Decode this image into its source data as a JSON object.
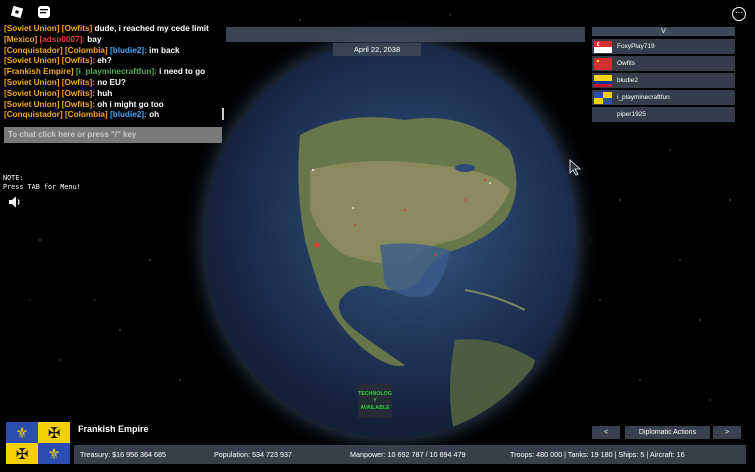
{
  "chat": {
    "messages": [
      {
        "tag": "[Soviet Union]",
        "tag_color": "#f5a623",
        "team": "[Owfits]",
        "team_color": "#f5a623",
        "text": "dude, i reached my cede limit"
      },
      {
        "tag": "[Mexico]",
        "tag_color": "#f5a623",
        "team": "[adso0007]:",
        "team_color": "#e53935",
        "text": "bay"
      },
      {
        "tag": "[Conquistador]",
        "tag_color": "#f5a623",
        "team": "[Colombia]",
        "team_color": "#f5a623",
        "name": "[bludie2]:",
        "name_color": "#42a5f5",
        "text": "im back"
      },
      {
        "tag": "[Soviet Union]",
        "tag_color": "#f5a623",
        "team": "[Owfits]:",
        "team_color": "#f5a623",
        "text": "eh?"
      },
      {
        "tag": "[Frankish Empire]",
        "tag_color": "#f5a623",
        "team": "[i_playminecraftfun]:",
        "team_color": "#4caf50",
        "text": "i need to go"
      },
      {
        "tag": "[Soviet Union]",
        "tag_color": "#f5a623",
        "team": "[Owfits]:",
        "team_color": "#f5a623",
        "text": "no EU?"
      },
      {
        "tag": "[Soviet Union]",
        "tag_color": "#f5a623",
        "team": "[Owfits]:",
        "team_color": "#f5a623",
        "text": "huh"
      },
      {
        "tag": "[Soviet Union]",
        "tag_color": "#f5a623",
        "team": "[Owfits]:",
        "team_color": "#f5a623",
        "text": "oh i might go too"
      },
      {
        "tag": "[Conquistador]",
        "tag_color": "#f5a623",
        "team": "[Colombia]",
        "team_color": "#f5a623",
        "name": "[bludie2]:",
        "name_color": "#42a5f5",
        "text": "oh"
      }
    ],
    "input_placeholder": "To chat click here or press \"/\" key"
  },
  "date": "April 22, 2038",
  "note": {
    "line1": "NOTE:",
    "line2": "Press TAB for Menu!"
  },
  "players": {
    "header": "V",
    "list": [
      {
        "name": "FoxyPlay719",
        "flag": "flag-red-white-crescent"
      },
      {
        "name": "Owfits",
        "flag": "flag-red-star"
      },
      {
        "name": "bludie2",
        "flag": "flag-colombia"
      },
      {
        "name": "i_playminecraftfun",
        "flag": "flag-frankish"
      },
      {
        "name": "piper1925",
        "flag": ""
      }
    ]
  },
  "tech_notice": "TECHNOLOG Y AVAILABLE",
  "country": {
    "name": "Frankish Empire"
  },
  "stats": {
    "treasury": "Treasury:  $16 956 364 685",
    "population": "Population: 534 723 937",
    "manpower": "Manpower:  10 692 787  /  10 694 479",
    "military": "Troops: 480 000  |  Tanks: 19 180  |  Ships: 5  |  Aircraft: 16"
  },
  "diplomacy": {
    "prev": "<",
    "label": "Diplomatic Actions",
    "next": ">"
  },
  "colors": {
    "accent_orange": "#f5a623",
    "tech_green": "#2ecc40",
    "panel": "#3c4452"
  }
}
